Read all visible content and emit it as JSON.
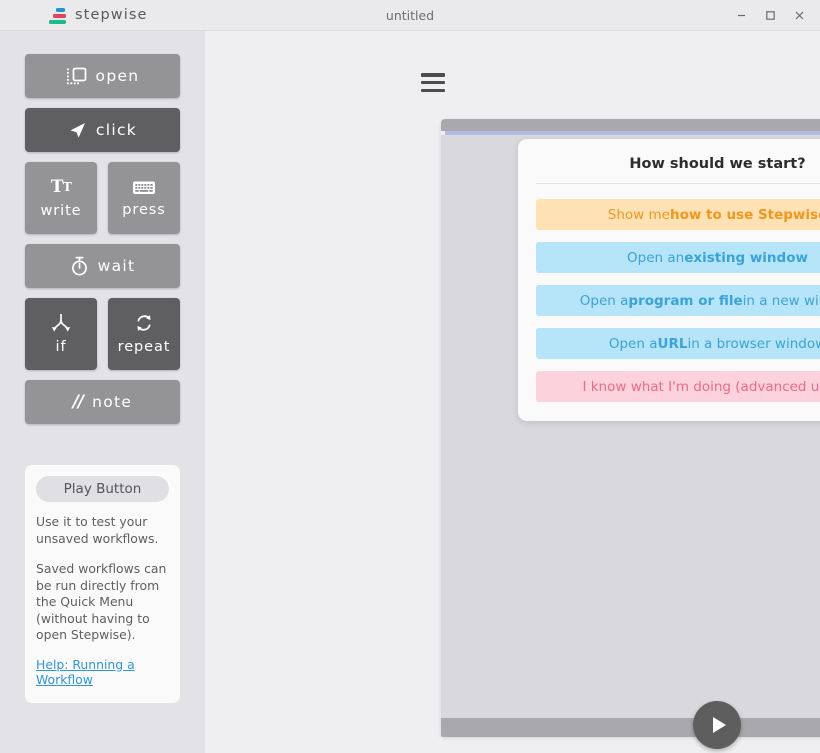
{
  "titlebar": {
    "brand": "stepwise",
    "logo_icon": "stepwise-stack-logo",
    "logo_colors": [
      "#2196c9",
      "#e8415c",
      "#1dbb8a"
    ],
    "window_title": "untitled",
    "controls": [
      {
        "name": "minimize",
        "icon": "minimize-icon"
      },
      {
        "name": "maximize",
        "icon": "maximize-icon"
      },
      {
        "name": "close",
        "icon": "close-icon"
      }
    ]
  },
  "sidebar": {
    "actions": [
      {
        "label": "open",
        "icon": "open-window-icon",
        "style": "wide",
        "tone": "light"
      },
      {
        "label": "click",
        "icon": "cursor-arrow-icon",
        "style": "wide",
        "tone": "dark"
      },
      {
        "label": "write",
        "icon": "text-tt-icon",
        "style": "half",
        "tone": "light"
      },
      {
        "label": "press",
        "icon": "keyboard-icon",
        "style": "half",
        "tone": "light"
      },
      {
        "label": "wait",
        "icon": "stopwatch-icon",
        "style": "wide",
        "tone": "light"
      },
      {
        "label": "if",
        "icon": "branch-arrows-icon",
        "style": "half",
        "tone": "dark"
      },
      {
        "label": "repeat",
        "icon": "loop-arrows-icon",
        "style": "half",
        "tone": "dark"
      },
      {
        "label": "note",
        "icon": "double-slash-icon",
        "style": "wide",
        "tone": "light"
      }
    ],
    "help": {
      "title": "Play Button",
      "paragraph_1": "Use it to test your unsaved workflows.",
      "paragraph_2": "Saved workflows can be run directly from the Quick Menu (without having to open Stepwise).",
      "link": "Help: Running a Workflow",
      "link_color": "#2f95dd"
    }
  },
  "main": {
    "menu_icon": "hamburger-menu-icon",
    "start_dialog": {
      "title": "How should we start?",
      "options": [
        {
          "prefix": "Show me ",
          "strong": "how to use Stepwise",
          "suffix": "",
          "tone": "tutorial",
          "color": "#f2961d",
          "bg": "#ffe2b4"
        },
        {
          "prefix": "Open an ",
          "strong": "existing window",
          "suffix": "",
          "tone": "blue",
          "color": "#3aa3d8",
          "bg": "#b6e4f9"
        },
        {
          "prefix": "Open a ",
          "strong": "program or file",
          "suffix": " in a new window",
          "tone": "blue",
          "color": "#3aa3d8",
          "bg": "#b6e4f9"
        },
        {
          "prefix": "Open a ",
          "strong": "URL",
          "suffix": " in a browser window",
          "tone": "blue",
          "color": "#3aa3d8",
          "bg": "#b6e4f9"
        },
        {
          "prefix": "I know what I'm doing (advanced users)",
          "strong": "",
          "suffix": "",
          "tone": "pink",
          "color": "#ef6a87",
          "bg": "#fcd2dc"
        }
      ]
    },
    "play_button": {
      "icon": "play-triangle-icon",
      "label": ""
    }
  }
}
